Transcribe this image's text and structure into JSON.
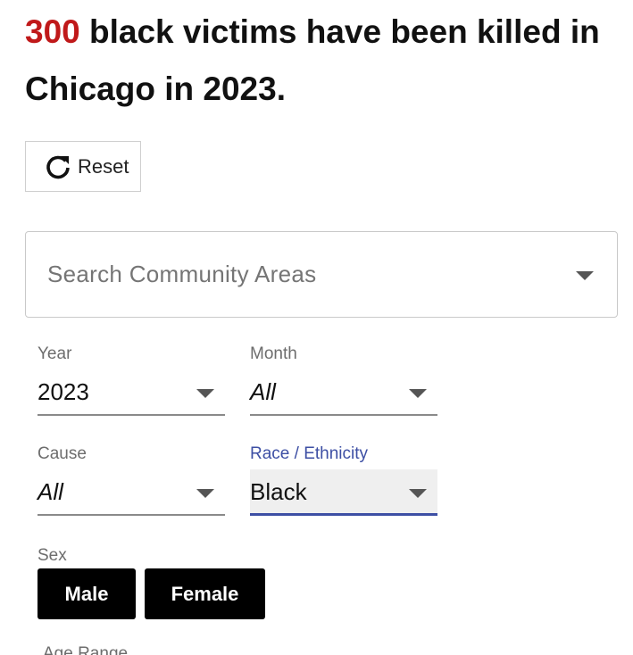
{
  "headline": {
    "count": "300",
    "text": " black victims have been killed in Chicago in 2023."
  },
  "reset": {
    "icon": "refresh-icon",
    "label": "Reset"
  },
  "search": {
    "placeholder": "Search Community Areas",
    "icon": "chevron-down-icon"
  },
  "filters": {
    "year": {
      "label": "Year",
      "value": "2023"
    },
    "month": {
      "label": "Month",
      "value": "All"
    },
    "cause": {
      "label": "Cause",
      "value": "All"
    },
    "race": {
      "label": "Race / Ethnicity",
      "value": "Black"
    }
  },
  "sex": {
    "label": "Sex",
    "options": [
      "Male",
      "Female"
    ]
  },
  "age": {
    "label": "Age Range"
  },
  "colors": {
    "accent_red": "#c0191a",
    "focus_blue": "#3d4fa4",
    "button_black": "#000000"
  }
}
